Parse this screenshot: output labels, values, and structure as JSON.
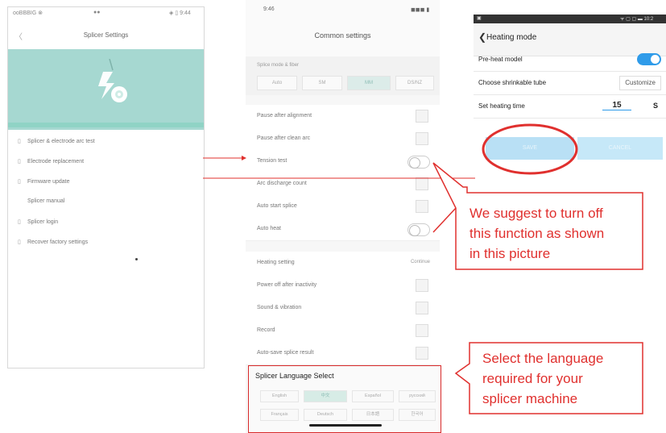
{
  "phone1": {
    "status_left": "ooBBBIG ⊗",
    "status_mid": "●●",
    "status_right": "◈ ▯ 9:44",
    "back_glyph": "〈",
    "title": "Splicer Settings",
    "menu_items": [
      {
        "icon": "▯",
        "label": "Splicer & electrode arc test"
      },
      {
        "icon": "▯",
        "label": "Electrode replacement"
      },
      {
        "icon": "▯",
        "label": "Firmware update"
      },
      {
        "icon": "",
        "label": "Splicer manual"
      },
      {
        "icon": "▯",
        "label": "Splicer login"
      },
      {
        "icon": "▯",
        "label": "Recover factory settings"
      }
    ]
  },
  "phone2": {
    "time": "9:46",
    "signal": "◼◼◼ ▮",
    "title": "Common settings",
    "section_label": "Splice mode & fiber",
    "mode_tabs": [
      {
        "label": "Auto",
        "selected": false
      },
      {
        "label": "SM",
        "selected": false
      },
      {
        "label": "MM",
        "selected": true
      },
      {
        "label": "DS/NZ",
        "selected": false
      }
    ],
    "rows_a": [
      {
        "label": "Pause after alignment",
        "control": "check"
      },
      {
        "label": "Pause after clean arc",
        "control": "check"
      },
      {
        "label": "Tension test",
        "control": "toggle",
        "on": false
      },
      {
        "label": "Arc discharge count",
        "control": "check"
      },
      {
        "label": "Auto start splice",
        "control": "check"
      },
      {
        "label": "Auto heat",
        "control": "toggle",
        "on": false
      }
    ],
    "rows_b": [
      {
        "label": "Heating setting",
        "value": "Continue"
      },
      {
        "label": "Power off after inactivity",
        "value": ""
      },
      {
        "label": "Sound & vibration",
        "value": ""
      },
      {
        "label": "Record",
        "value": ""
      },
      {
        "label": "Auto-save splice result",
        "value": ""
      }
    ],
    "language_box": {
      "title": "Splicer Language Select",
      "languages_row1": [
        {
          "label": "English",
          "selected": false
        },
        {
          "label": "中文",
          "selected": true
        },
        {
          "label": "Español",
          "selected": false
        },
        {
          "label": "русский",
          "selected": false
        }
      ],
      "languages_row2": [
        {
          "label": "Français",
          "selected": false
        },
        {
          "label": "Deutsch",
          "selected": false
        },
        {
          "label": "日本語",
          "selected": false
        },
        {
          "label": "한국어",
          "selected": false
        }
      ]
    }
  },
  "phone3": {
    "status_left": "▣",
    "status_right": "ᯤ ▢ ▢ ▬ 10:2",
    "back_glyph": "❮",
    "header_title": "Heating mode",
    "preheat_label": "Pre-heat model",
    "preheat_on": true,
    "tube_label": "Choose shrinkable tube",
    "tube_value": "Customize",
    "time_label": "Set heating time",
    "time_value": "15",
    "time_unit": "S",
    "save_label": "SAVE",
    "cancel_label": "CANCEL"
  },
  "annotations": {
    "suggestion_lines": [
      "We suggest to turn off",
      "this function as shown",
      "in this picture"
    ],
    "language_lines": [
      "Select the language",
      "required for your",
      "splicer machine"
    ],
    "accent_color": "#e0302e"
  }
}
